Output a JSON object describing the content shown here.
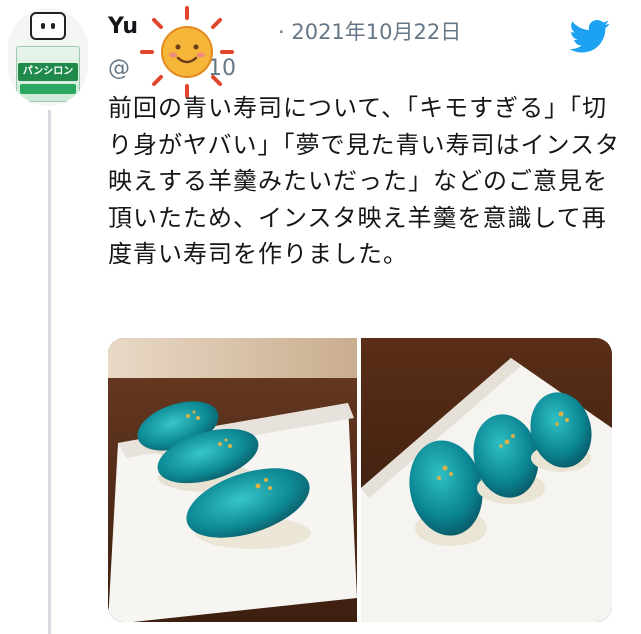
{
  "tweet": {
    "author_name": "Yu",
    "handle": "@",
    "handle_suffix": "10",
    "date": "· 2021年10月22日",
    "text": "前回の青い寿司について、「キモすぎる」「切り身がヤバい」「夢で見た青い寿司はインスタ映えする羊羹みたいだった」などのご意見を頂いたため、インスタ映え羊羹を意識して再度青い寿司を作りました。",
    "avatar": {
      "icon": "pansiron-package-avatar",
      "product_label": "パンシロン"
    },
    "brand_icon": "twitter-bird-icon",
    "sticker_icon": "smiling-sun-sticker"
  },
  "media": {
    "photos": [
      {
        "name": "blue-sushi-photo-left",
        "alt": "blue sushi on white plate"
      },
      {
        "name": "blue-sushi-photo-right",
        "alt": "blue sushi on white plate"
      }
    ]
  },
  "colors": {
    "twitter_blue": "#1da1f2",
    "secondary_text": "#657786",
    "sushi_teal": "#0f8f9a"
  }
}
